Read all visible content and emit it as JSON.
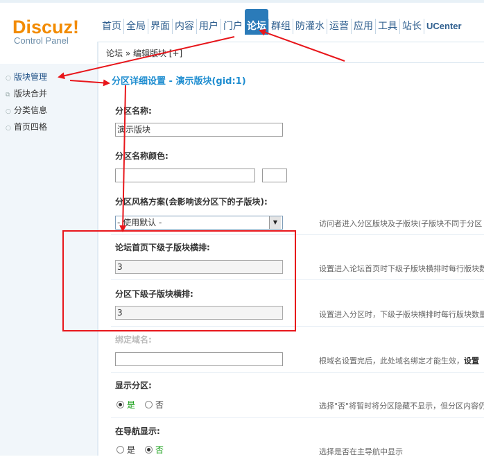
{
  "header": {
    "logo": "Discuz!",
    "logo_sub": "Control Panel",
    "nav": [
      "首页",
      "全局",
      "界面",
      "内容",
      "用户",
      "门户",
      "论坛",
      "群组",
      "防灌水",
      "运营",
      "应用",
      "工具",
      "站长",
      "UCenter"
    ],
    "active_nav": "论坛"
  },
  "breadcrumb": "论坛 » 编辑版块 [+]",
  "sidebar": {
    "items": [
      {
        "label": "版块管理",
        "active": true
      },
      {
        "label": "版块合并",
        "active": false
      },
      {
        "label": "分类信息",
        "active": false
      },
      {
        "label": "首页四格",
        "active": false
      }
    ]
  },
  "main": {
    "title": "分区详细设置 - 演示版块(gid:1)",
    "fields": {
      "name": {
        "label": "分区名称:",
        "value": "演示版块"
      },
      "name_color": {
        "label": "分区名称颜色:",
        "value": ""
      },
      "style": {
        "label": "分区风格方案(会影响该分区下的子版块):",
        "value": "- 使用默认 -",
        "hint": "访问者进入分区版块及子版块(子版块不同于分区"
      },
      "home_cols": {
        "label": "论坛首页下级子版块横排:",
        "value": "3",
        "hint": "设置进入论坛首页时下级子版块横排时每行版块数"
      },
      "sub_cols": {
        "label": "分区下级子版块横排:",
        "value": "3",
        "hint": "设置进入分区时，下级子版块横排时每行版块数量"
      },
      "domain": {
        "label": "绑定域名:",
        "value": "",
        "hint": "根域名设置完后，此处域名绑定才能生效，",
        "hint_link": "设置"
      },
      "show": {
        "label": "显示分区:",
        "options": [
          "是",
          "否"
        ],
        "selected": "是",
        "hint": "选择\"否\"将暂时将分区隐藏不显示，但分区内容仍"
      },
      "nav": {
        "label": "在导航显示:",
        "options": [
          "是",
          "否"
        ],
        "selected": "否",
        "hint": "选择是否在主导航中显示"
      }
    }
  },
  "colors": {
    "accent": "#2b7bb9",
    "title": "#1e8dd0",
    "annotation": "#e8161b",
    "logo": "#f28b00"
  }
}
